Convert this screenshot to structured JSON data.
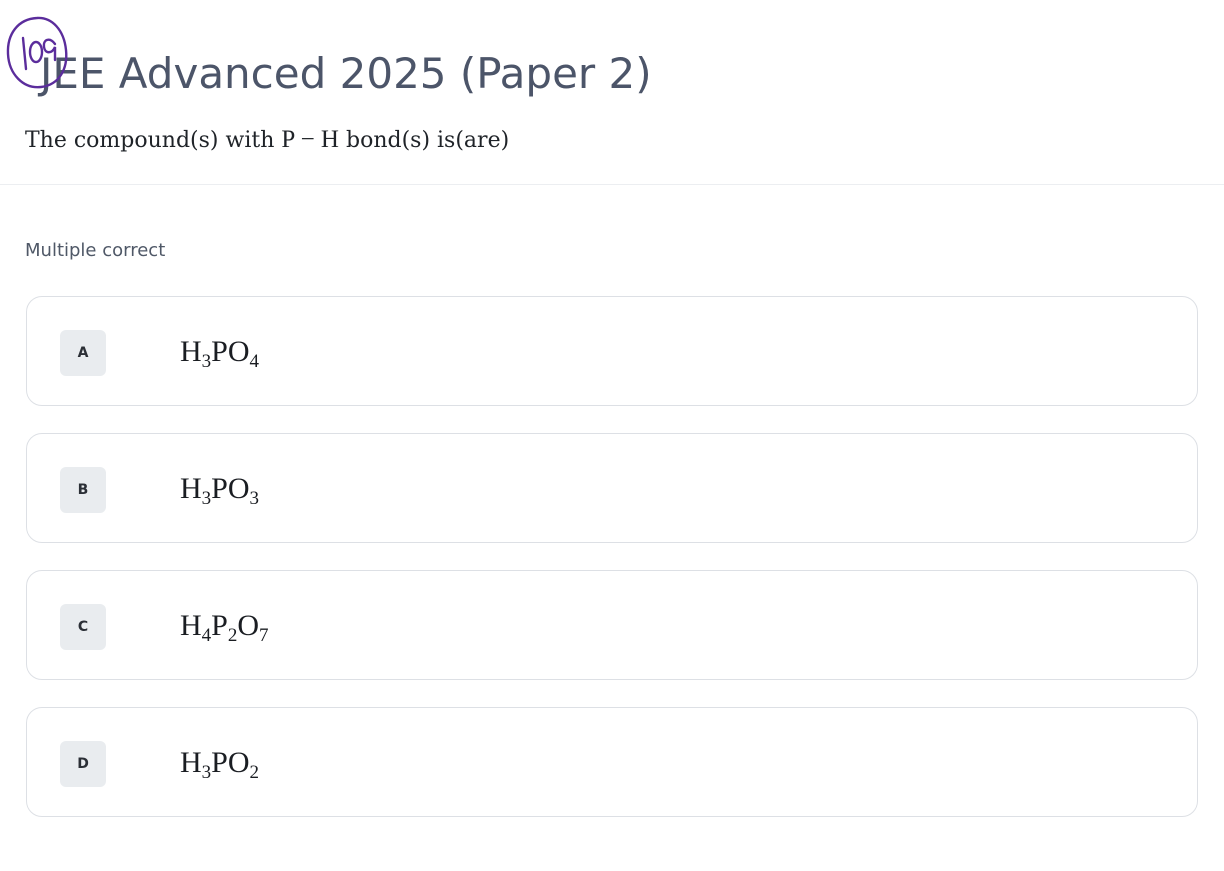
{
  "page": {
    "title": "JEE Advanced 2025 (Paper 2)",
    "annotation": "109"
  },
  "question": {
    "prefix": "The compound(s) with ",
    "math": "P − H",
    "suffix": " bond(s) is(are)",
    "type": "Multiple correct"
  },
  "options": [
    {
      "label": "A",
      "parts": [
        {
          "t": "H"
        },
        {
          "s": "3"
        },
        {
          "t": "PO"
        },
        {
          "s": "4"
        }
      ]
    },
    {
      "label": "B",
      "parts": [
        {
          "t": "H"
        },
        {
          "s": "3"
        },
        {
          "t": "PO"
        },
        {
          "s": "3"
        }
      ]
    },
    {
      "label": "C",
      "parts": [
        {
          "t": "H"
        },
        {
          "s": "4"
        },
        {
          "t": "P"
        },
        {
          "s": "2"
        },
        {
          "t": "O"
        },
        {
          "s": "7"
        }
      ]
    },
    {
      "label": "D",
      "parts": [
        {
          "t": "H"
        },
        {
          "s": "3"
        },
        {
          "t": "PO"
        },
        {
          "s": "2"
        }
      ]
    }
  ],
  "colors": {
    "title": "#4c5569",
    "annotation_ink": "#5b2d9c",
    "badge_bg": "#e9ecef",
    "card_border": "#dde0e5"
  }
}
